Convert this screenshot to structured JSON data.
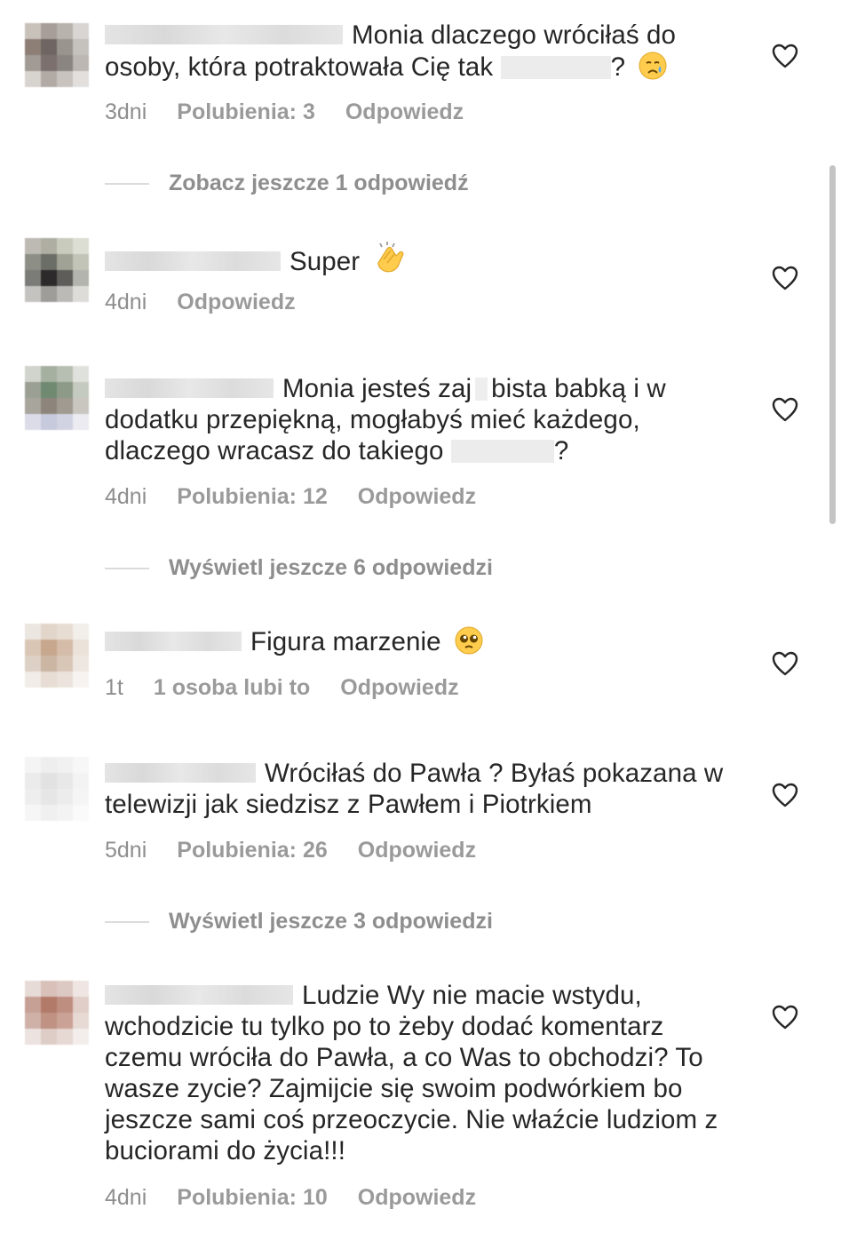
{
  "colors": {
    "text": "#262626",
    "meta": "#8e8e8e",
    "censor": "#ececec",
    "divider": "#dbdbdb"
  },
  "comments": [
    {
      "text_before": "Monia dlaczego wróciłaś do osoby, która potraktowała Cię tak",
      "text_after": "? ",
      "emoji": "crying-face-icon",
      "time": "3dni",
      "likes": "Polubienia: 3",
      "reply": "Odpowiedz",
      "more_replies": "Zobacz jeszcze 1 odpowiedź"
    },
    {
      "text_before": "Super",
      "text_after": "",
      "emoji": "clapping-hands-icon",
      "time": "4dni",
      "likes": "",
      "reply": "Odpowiedz"
    },
    {
      "text_before": "Monia jesteś zaj",
      "text_mid": "bista babką i w dodatku przepiękną, mogłabyś mieć każdego, dlaczego wracasz do takiego",
      "text_after": "?",
      "time": "4dni",
      "likes": "Polubienia: 12",
      "reply": "Odpowiedz",
      "more_replies": "Wyświetl jeszcze 6 odpowiedzi"
    },
    {
      "text_before": "Figura marzenie",
      "emoji": "pleading-face-icon",
      "time": "1t",
      "likes": "1 osoba lubi to",
      "reply": "Odpowiedz"
    },
    {
      "text_before": "Wróciłaś do Pawła ? Byłaś pokazana w telewizji jak siedzisz z Pawłem i Piotrkiem",
      "time": "5dni",
      "likes": "Polubienia: 26",
      "reply": "Odpowiedz",
      "more_replies": "Wyświetl jeszcze 3 odpowiedzi"
    },
    {
      "text_before": "Ludzie Wy nie macie wstydu, wchodzicie tu tylko po to żeby dodać komentarz czemu wróciła do Pawła, a co Was to obchodzi? To wasze zycie? Zajmijcie się swoim podwórkiem bo jeszcze sami coś przeoczycie. Nie właźcie ludziom z buciorami do życia!!!",
      "time": "4dni",
      "likes": "Polubienia: 10",
      "reply": "Odpowiedz"
    }
  ]
}
